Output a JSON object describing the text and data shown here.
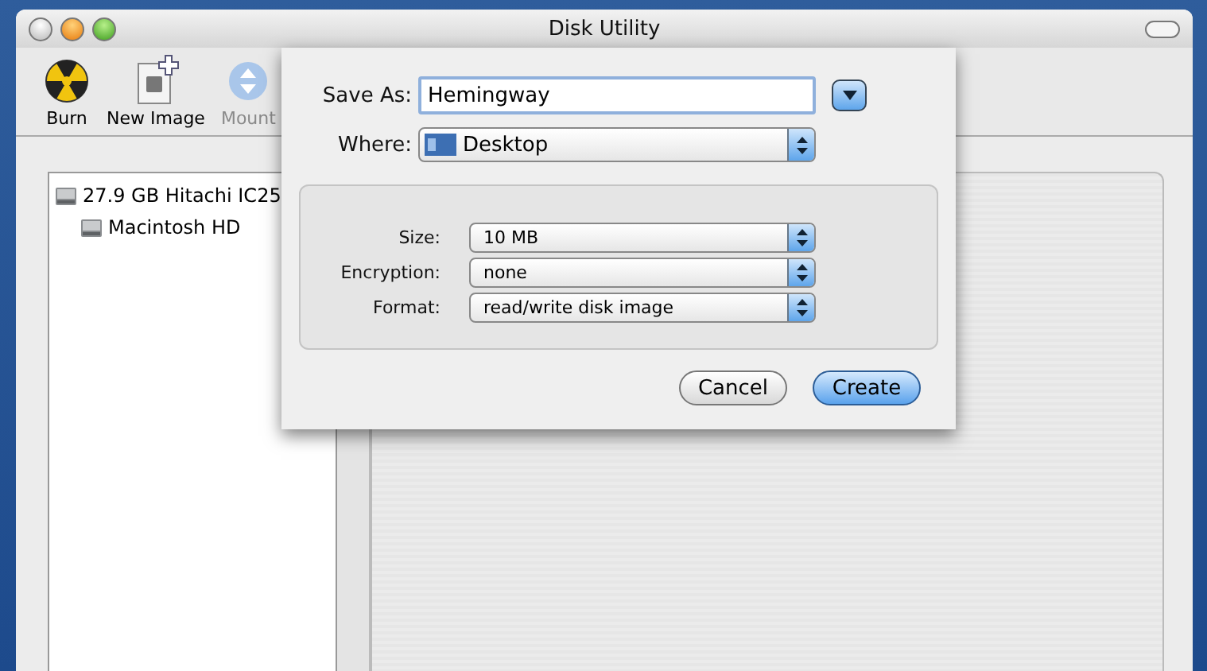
{
  "window": {
    "title": "Disk Utility"
  },
  "toolbar": [
    {
      "kind": "burn",
      "label": "Burn",
      "disabled": false
    },
    {
      "kind": "new-image",
      "label": "New Image",
      "disabled": false
    },
    {
      "kind": "mount",
      "label": "Mount",
      "disabled": true
    }
  ],
  "sidebar": {
    "items": [
      {
        "label": "27.9 GB Hitachi IC25",
        "children": [
          {
            "label": "Macintosh HD"
          }
        ]
      }
    ]
  },
  "sheet": {
    "save_as": {
      "label": "Save As:",
      "value": "Hemingway"
    },
    "where": {
      "label": "Where:",
      "value": "Desktop"
    },
    "options": [
      {
        "label": "Size:",
        "value": "10 MB"
      },
      {
        "label": "Encryption:",
        "value": "none"
      },
      {
        "label": "Format:",
        "value": "read/write disk image"
      }
    ],
    "buttons": [
      {
        "label": "Cancel",
        "default": false
      },
      {
        "label": "Create",
        "default": true
      }
    ]
  }
}
